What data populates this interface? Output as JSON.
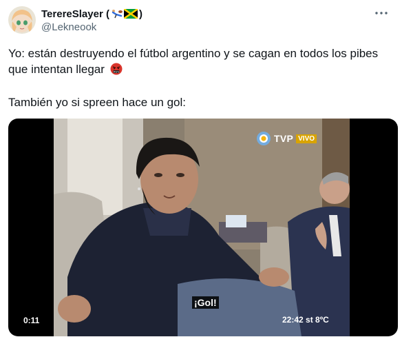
{
  "author": {
    "display_name": "TerereSlayer",
    "handle": "@Lekneook",
    "flag_emojis": [
      "rugby-player-emoji",
      "jamaica-flag-emoji"
    ]
  },
  "tweet": {
    "text_line1": "Yo: están destruyendo el fútbol argentino y se cagan en todos los pibes",
    "text_line2": "que intentan llegar",
    "emoji": "face-with-symbols-on-mouth",
    "text_line3": "También yo si spreen hace un gol:"
  },
  "video": {
    "timer": "0:11",
    "channel": "TVP",
    "live_badge": "VIVO",
    "subtitle": "¡Gol!",
    "clock": "22:42 st 8ºC"
  },
  "colors": {
    "text": "#0f1419",
    "secondary": "#536471",
    "live_badge": "#d9a400"
  }
}
